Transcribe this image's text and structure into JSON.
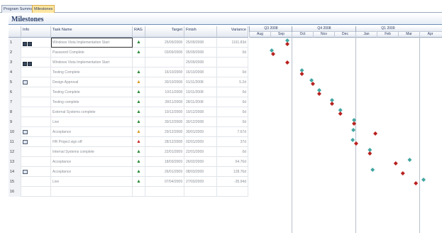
{
  "tabs": [
    {
      "label": "Program Summary",
      "active": false
    },
    {
      "label": "Milestones",
      "active": true
    }
  ],
  "panel_title": "Milestones",
  "columns": {
    "info": "Info",
    "task": "Task Name",
    "rag": "RAG",
    "target": "Target",
    "finish": "Finish",
    "variance": "Variance"
  },
  "timeline": {
    "quarters": [
      "Q3 2008",
      "Q4 2008",
      "Q1 2009"
    ],
    "months": [
      "Aug",
      "Sep",
      "Oct",
      "Nov",
      "Dec",
      "Jan",
      "Feb",
      "Mar",
      "Apr"
    ]
  },
  "rows": [
    {
      "n": "1",
      "info": "pair",
      "task": "Windows Vista Implementation Start",
      "rag": "green",
      "target": "25/09/2008",
      "finish": "25/09/2008",
      "variance": "1161.83d",
      "selected": true
    },
    {
      "n": "2",
      "info": "",
      "task": "Password Complete",
      "rag": "green",
      "target": "03/09/2008",
      "finish": "05/09/2008",
      "variance": "0d"
    },
    {
      "n": "3",
      "info": "pair",
      "task": "Windows Vista Implementation Start",
      "rag": "",
      "target": "",
      "finish": "25/09/2008",
      "variance": ""
    },
    {
      "n": "4",
      "info": "",
      "task": "Testing Complete",
      "rag": "green",
      "target": "16/10/2008",
      "finish": "16/10/2008",
      "variance": "0d"
    },
    {
      "n": "5",
      "info": "doc",
      "task": "Design Approval",
      "rag": "amber",
      "target": "30/10/2008",
      "finish": "01/11/2008",
      "variance": "5.2d"
    },
    {
      "n": "6",
      "info": "",
      "task": "Testing Complete",
      "rag": "green",
      "target": "10/11/2008",
      "finish": "10/11/2008",
      "variance": "0d"
    },
    {
      "n": "7",
      "info": "",
      "task": "Testing complete",
      "rag": "green",
      "target": "28/11/2008",
      "finish": "28/11/2008",
      "variance": "0d"
    },
    {
      "n": "8",
      "info": "",
      "task": "External Systems complete",
      "rag": "green",
      "target": "10/12/2008",
      "finish": "10/12/2008",
      "variance": "0d"
    },
    {
      "n": "9",
      "info": "",
      "task": "Live",
      "rag": "green",
      "target": "30/12/2008",
      "finish": "30/12/2008",
      "variance": "0d"
    },
    {
      "n": "10",
      "info": "doc",
      "task": "Acceptance",
      "rag": "amber",
      "target": "29/12/2008",
      "finish": "30/01/2009",
      "variance": "7.67d"
    },
    {
      "n": "11",
      "info": "doc",
      "task": "HR Project sign off",
      "rag": "red",
      "target": "28/12/2008",
      "finish": "02/01/2009",
      "variance": "37d"
    },
    {
      "n": "12",
      "info": "",
      "task": "Internal Systems complete",
      "rag": "green",
      "target": "22/01/2009",
      "finish": "22/01/2009",
      "variance": "0d"
    },
    {
      "n": "13",
      "info": "",
      "task": "Acceptance",
      "rag": "green",
      "target": "18/03/2009",
      "finish": "26/02/2009",
      "variance": "64.76d"
    },
    {
      "n": "14",
      "info": "doc",
      "task": "Acceptance",
      "rag": "green",
      "target": "26/01/2009",
      "finish": "08/03/2009",
      "variance": "128.76d"
    },
    {
      "n": "15",
      "info": "",
      "task": "Live",
      "rag": "green",
      "target": "07/04/2009",
      "finish": "27/03/2009",
      "variance": "-35.94d"
    },
    {
      "n": "16",
      "info": "",
      "task": "",
      "rag": "",
      "target": "",
      "finish": "",
      "variance": ""
    }
  ],
  "rag_colors": {
    "green": "#2e8b3a",
    "amber": "#d9a02a",
    "red": "#c62828"
  },
  "marker_colors": {
    "target": "#43a6a1",
    "finish": "#b8211f"
  }
}
